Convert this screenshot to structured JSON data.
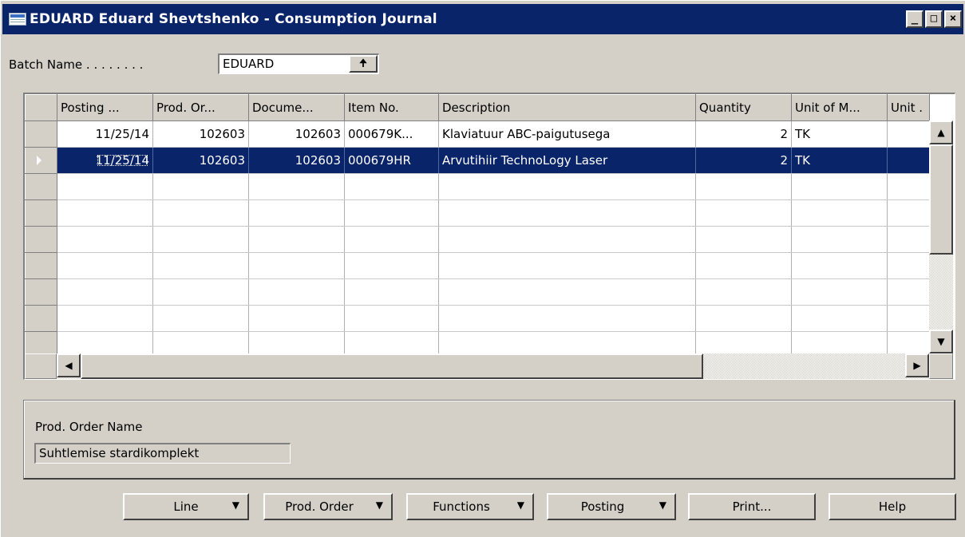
{
  "window": {
    "title": "EDUARD Eduard Shevtshenko - Consumption Journal",
    "controls": {
      "minimize": "_",
      "maximize": "□",
      "close": "×"
    }
  },
  "batch": {
    "label": "Batch Name . . . . . . . .",
    "value": "EDUARD",
    "lookup_icon": "up-arrow-icon"
  },
  "grid": {
    "columns": [
      "Posting ...",
      "Prod. Or...",
      "Docume...",
      "Item No.",
      "Description",
      "Quantity",
      "Unit of M...",
      "Unit ."
    ],
    "rows": [
      {
        "posting": "11/25/14",
        "prod_order": "102603",
        "document": "102603",
        "item_no": "000679K...",
        "description": "Klaviatuur ABC-paigutusega",
        "quantity": "2",
        "unit": "TK",
        "unit2": ""
      },
      {
        "posting": "11/25/14",
        "prod_order": "102603",
        "document": "102603",
        "item_no": "000679HR",
        "description": "Arvutihiir TechnoLogy Laser",
        "quantity": "2",
        "unit": "TK",
        "unit2": ""
      }
    ],
    "selected_row": 1
  },
  "info_panel": {
    "label": "Prod. Order Name",
    "value": "Suhtlemise stardikomplekt"
  },
  "buttons": {
    "line": "Line",
    "prod_order": "Prod. Order",
    "functions": "Functions",
    "posting": "Posting",
    "print": "Print...",
    "help": "Help"
  },
  "colors": {
    "titlebar": "#0a246a",
    "selection": "#0a246a",
    "face": "#d4d0c8"
  }
}
